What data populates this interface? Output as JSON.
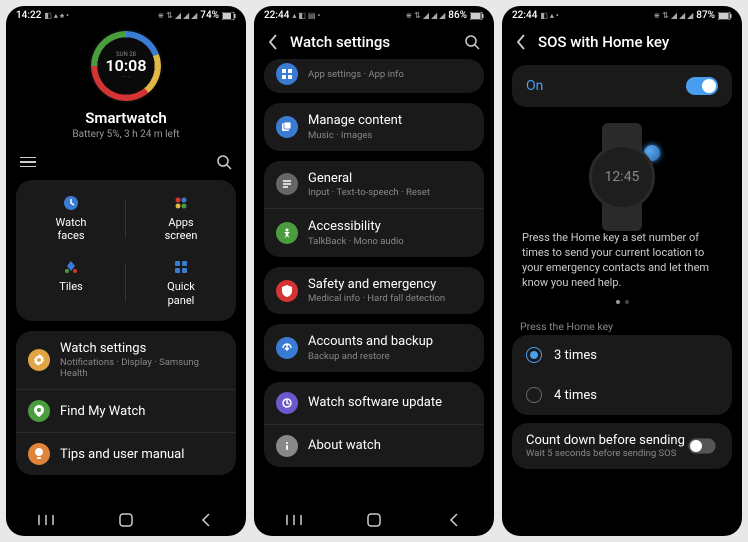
{
  "screen1": {
    "status": {
      "time": "14:22",
      "battery": "74%"
    },
    "watchface": {
      "date": "SUN 28",
      "time": "10:08",
      "sub": "··· ··"
    },
    "device": {
      "name": "Smartwatch",
      "sub": "Battery 5%, 3 h 24 m left"
    },
    "grid": [
      {
        "label": "Watch\nfaces"
      },
      {
        "label": "Apps\nscreen"
      },
      {
        "label": "Tiles"
      },
      {
        "label": "Quick\npanel"
      }
    ],
    "settings": [
      {
        "title": "Watch settings",
        "sub": "Notifications · Display · Samsung Health"
      },
      {
        "title": "Find My Watch"
      },
      {
        "title": "Tips and user manual"
      }
    ]
  },
  "screen2": {
    "status": {
      "time": "22:44",
      "battery": "86%"
    },
    "header": "Watch settings",
    "items": [
      {
        "sub": "App settings · App info"
      },
      {
        "title": "Manage content",
        "sub": "Music · Images"
      },
      {
        "title": "General",
        "sub": "Input · Text-to-speech · Reset"
      },
      {
        "title": "Accessibility",
        "sub": "TalkBack · Mono audio"
      },
      {
        "title": "Safety and emergency",
        "sub": "Medical info · Hard fall detection"
      },
      {
        "title": "Accounts and backup",
        "sub": "Backup and restore"
      },
      {
        "title": "Watch software update"
      },
      {
        "title": "About watch"
      }
    ]
  },
  "screen3": {
    "status": {
      "time": "22:44",
      "battery": "87%"
    },
    "header": "SOS with Home key",
    "toggle": {
      "label": "On",
      "state": true
    },
    "watch_time": "12:45",
    "description": "Press the Home key a set number of times to send your current location to your emergency contacts and let them know you need help.",
    "radio_section": "Press the Home key",
    "radio_options": [
      {
        "label": "3 times",
        "checked": true
      },
      {
        "label": "4 times",
        "checked": false
      }
    ],
    "countdown": {
      "title": "Count down before sending",
      "sub": "Wait 5 seconds before sending SOS"
    }
  }
}
